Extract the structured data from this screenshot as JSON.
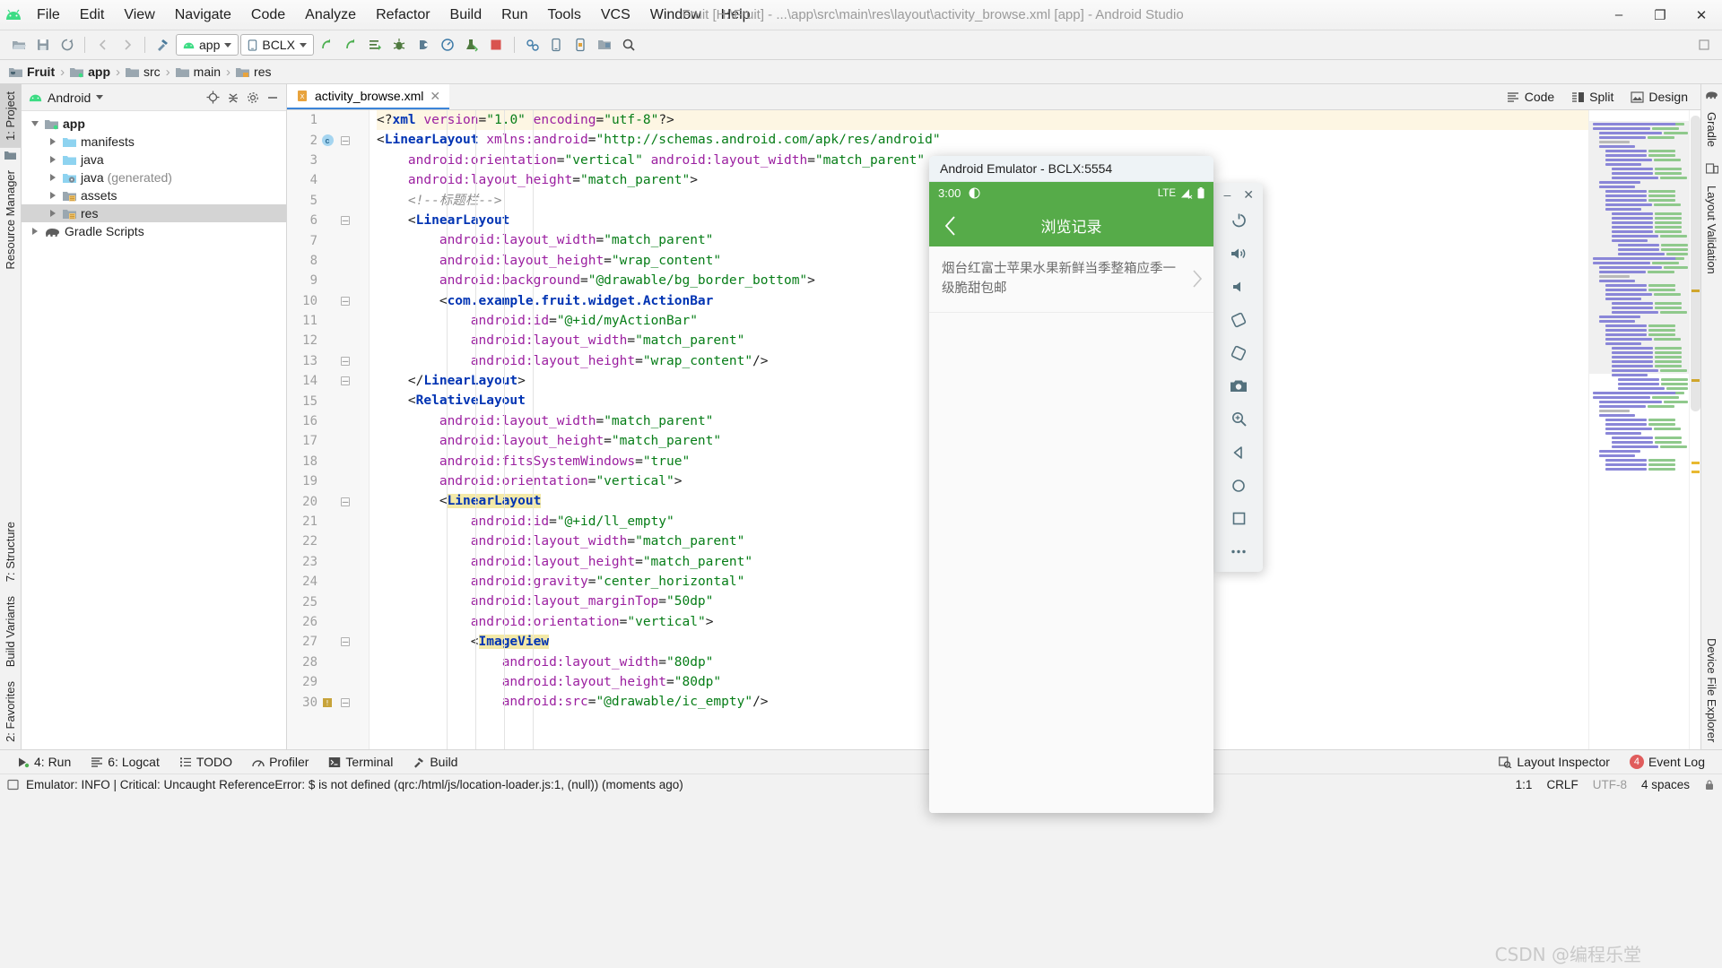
{
  "window": {
    "title": "Fruit [H:\\Fruit] - ...\\app\\src\\main\\res\\layout\\activity_browse.xml [app] - Android Studio",
    "minimize": "–",
    "maximize": "❐",
    "close": "✕"
  },
  "menubar": [
    {
      "label": "File"
    },
    {
      "label": "Edit"
    },
    {
      "label": "View"
    },
    {
      "label": "Navigate"
    },
    {
      "label": "Code"
    },
    {
      "label": "Analyze"
    },
    {
      "label": "Refactor"
    },
    {
      "label": "Build"
    },
    {
      "label": "Run"
    },
    {
      "label": "Tools"
    },
    {
      "label": "VCS"
    },
    {
      "label": "Window"
    },
    {
      "label": "Help"
    }
  ],
  "toolbar": {
    "module_selector": "app",
    "device_selector": "BCLX"
  },
  "breadcrumb": [
    {
      "label": "Fruit",
      "bold": true
    },
    {
      "label": "app",
      "bold": true
    },
    {
      "label": "src",
      "bold": false
    },
    {
      "label": "main",
      "bold": false
    },
    {
      "label": "res",
      "bold": false
    }
  ],
  "project_panel": {
    "title": "Android",
    "tree": [
      {
        "label": "app",
        "indent": 0,
        "expanded": true,
        "bold": true,
        "selected": false,
        "icon": "module-folder"
      },
      {
        "label": "manifests",
        "indent": 1,
        "expanded": false,
        "bold": false,
        "selected": false,
        "icon": "blue-folder"
      },
      {
        "label": "java",
        "indent": 1,
        "expanded": false,
        "bold": false,
        "selected": false,
        "icon": "blue-folder"
      },
      {
        "label": "java",
        "suffix": " (generated)",
        "indent": 1,
        "expanded": false,
        "bold": false,
        "selected": false,
        "icon": "generated-folder"
      },
      {
        "label": "assets",
        "indent": 1,
        "expanded": false,
        "bold": false,
        "selected": false,
        "icon": "res-folder"
      },
      {
        "label": "res",
        "indent": 1,
        "expanded": false,
        "bold": false,
        "selected": true,
        "icon": "res-folder"
      },
      {
        "label": "Gradle Scripts",
        "indent": 0,
        "expanded": false,
        "bold": false,
        "selected": false,
        "icon": "gradle"
      }
    ]
  },
  "left_rail": {
    "top": [
      {
        "label": "1: Project",
        "selected": true
      },
      {
        "label": "Resource Manager",
        "selected": false
      }
    ],
    "bottom": [
      {
        "label": "7: Structure"
      },
      {
        "label": "Build Variants"
      },
      {
        "label": "2: Favorites"
      }
    ]
  },
  "right_rail": [
    {
      "label": "Gradle"
    },
    {
      "label": "Layout Validation"
    }
  ],
  "editor": {
    "tab": {
      "name": "activity_browse.xml",
      "close": "✕"
    },
    "modes": [
      {
        "label": "Code",
        "active": false
      },
      {
        "label": "Split",
        "active": false
      },
      {
        "label": "Design",
        "active": false
      }
    ],
    "lines": [
      {
        "n": 1,
        "highlight": true,
        "fold": "",
        "mark": "",
        "indent": 0,
        "tokens": [
          {
            "t": "punc",
            "v": "<?"
          },
          {
            "t": "tag",
            "v": "xml"
          },
          {
            "t": "punc",
            "v": " "
          },
          {
            "t": "attr",
            "v": "version"
          },
          {
            "t": "eq",
            "v": "="
          },
          {
            "t": "val",
            "v": "\"1.0\""
          },
          {
            "t": "punc",
            "v": " "
          },
          {
            "t": "attr",
            "v": "encoding"
          },
          {
            "t": "eq",
            "v": "="
          },
          {
            "t": "val",
            "v": "\"utf-8\""
          },
          {
            "t": "punc",
            "v": "?>"
          }
        ]
      },
      {
        "n": 2,
        "highlight": false,
        "fold": "minus",
        "mark": "c",
        "indent": 0,
        "tokens": [
          {
            "t": "punc",
            "v": "<"
          },
          {
            "t": "tag",
            "v": "LinearLayout"
          },
          {
            "t": "punc",
            "v": " "
          },
          {
            "t": "attr",
            "v": "xmlns:android"
          },
          {
            "t": "eq",
            "v": "="
          },
          {
            "t": "val",
            "v": "\"http://schemas.android.com/apk/res/android\""
          }
        ]
      },
      {
        "n": 3,
        "highlight": false,
        "fold": "",
        "mark": "",
        "indent": 1,
        "tokens": [
          {
            "t": "attr",
            "v": "android:orientation"
          },
          {
            "t": "eq",
            "v": "="
          },
          {
            "t": "val",
            "v": "\"vertical\""
          },
          {
            "t": "punc",
            "v": " "
          },
          {
            "t": "attr",
            "v": "android:layout_width"
          },
          {
            "t": "eq",
            "v": "="
          },
          {
            "t": "val",
            "v": "\"match_parent\""
          }
        ]
      },
      {
        "n": 4,
        "highlight": false,
        "fold": "",
        "mark": "",
        "indent": 1,
        "tokens": [
          {
            "t": "attr",
            "v": "android:layout_height"
          },
          {
            "t": "eq",
            "v": "="
          },
          {
            "t": "val",
            "v": "\"match_parent\""
          },
          {
            "t": "punc",
            "v": ">"
          }
        ]
      },
      {
        "n": 5,
        "highlight": false,
        "fold": "",
        "mark": "",
        "indent": 1,
        "tokens": [
          {
            "t": "comment",
            "v": "<!--标题栏-->"
          }
        ]
      },
      {
        "n": 6,
        "highlight": false,
        "fold": "minus",
        "mark": "",
        "indent": 1,
        "tokens": [
          {
            "t": "punc",
            "v": "<"
          },
          {
            "t": "tag",
            "v": "LinearLayout"
          }
        ]
      },
      {
        "n": 7,
        "highlight": false,
        "fold": "",
        "mark": "",
        "indent": 2,
        "tokens": [
          {
            "t": "attr",
            "v": "android:layout_width"
          },
          {
            "t": "eq",
            "v": "="
          },
          {
            "t": "val",
            "v": "\"match_parent\""
          }
        ]
      },
      {
        "n": 8,
        "highlight": false,
        "fold": "",
        "mark": "",
        "indent": 2,
        "tokens": [
          {
            "t": "attr",
            "v": "android:layout_height"
          },
          {
            "t": "eq",
            "v": "="
          },
          {
            "t": "val",
            "v": "\"wrap_content\""
          }
        ]
      },
      {
        "n": 9,
        "highlight": false,
        "fold": "",
        "mark": "",
        "indent": 2,
        "tokens": [
          {
            "t": "attr",
            "v": "android:background"
          },
          {
            "t": "eq",
            "v": "="
          },
          {
            "t": "val",
            "v": "\"@drawable/bg_border_bottom\""
          },
          {
            "t": "punc",
            "v": ">"
          }
        ]
      },
      {
        "n": 10,
        "highlight": false,
        "fold": "minus",
        "mark": "",
        "indent": 2,
        "tokens": [
          {
            "t": "punc",
            "v": "<"
          },
          {
            "t": "tag",
            "v": "com.example.fruit.widget.ActionBar"
          }
        ]
      },
      {
        "n": 11,
        "highlight": false,
        "fold": "",
        "mark": "",
        "indent": 3,
        "tokens": [
          {
            "t": "attr",
            "v": "android:id"
          },
          {
            "t": "eq",
            "v": "="
          },
          {
            "t": "val",
            "v": "\"@+id/myActionBar\""
          }
        ]
      },
      {
        "n": 12,
        "highlight": false,
        "fold": "",
        "mark": "",
        "indent": 3,
        "tokens": [
          {
            "t": "attr",
            "v": "android:layout_width"
          },
          {
            "t": "eq",
            "v": "="
          },
          {
            "t": "val",
            "v": "\"match_parent\""
          }
        ]
      },
      {
        "n": 13,
        "highlight": false,
        "fold": "minus",
        "mark": "",
        "indent": 3,
        "tokens": [
          {
            "t": "attr",
            "v": "android:layout_height"
          },
          {
            "t": "eq",
            "v": "="
          },
          {
            "t": "val",
            "v": "\"wrap_content\""
          },
          {
            "t": "punc",
            "v": "/>"
          }
        ]
      },
      {
        "n": 14,
        "highlight": false,
        "fold": "minus",
        "mark": "",
        "indent": 1,
        "tokens": [
          {
            "t": "punc",
            "v": "</"
          },
          {
            "t": "tag",
            "v": "LinearLayout"
          },
          {
            "t": "punc",
            "v": ">"
          }
        ]
      },
      {
        "n": 15,
        "highlight": false,
        "fold": "",
        "mark": "",
        "indent": 1,
        "tokens": [
          {
            "t": "punc",
            "v": "<"
          },
          {
            "t": "tag",
            "v": "RelativeLayout"
          }
        ]
      },
      {
        "n": 16,
        "highlight": false,
        "fold": "",
        "mark": "",
        "indent": 2,
        "tokens": [
          {
            "t": "attr",
            "v": "android:layout_width"
          },
          {
            "t": "eq",
            "v": "="
          },
          {
            "t": "val",
            "v": "\"match_parent\""
          }
        ]
      },
      {
        "n": 17,
        "highlight": false,
        "fold": "",
        "mark": "",
        "indent": 2,
        "tokens": [
          {
            "t": "attr",
            "v": "android:layout_height"
          },
          {
            "t": "eq",
            "v": "="
          },
          {
            "t": "val",
            "v": "\"match_parent\""
          }
        ]
      },
      {
        "n": 18,
        "highlight": false,
        "fold": "",
        "mark": "",
        "indent": 2,
        "tokens": [
          {
            "t": "attr",
            "v": "android:fitsSystemWindows"
          },
          {
            "t": "eq",
            "v": "="
          },
          {
            "t": "val",
            "v": "\"true\""
          }
        ]
      },
      {
        "n": 19,
        "highlight": false,
        "fold": "",
        "mark": "",
        "indent": 2,
        "tokens": [
          {
            "t": "attr",
            "v": "android:orientation"
          },
          {
            "t": "eq",
            "v": "="
          },
          {
            "t": "val",
            "v": "\"vertical\""
          },
          {
            "t": "punc",
            "v": ">"
          }
        ]
      },
      {
        "n": 20,
        "highlight": false,
        "fold": "minus",
        "mark": "",
        "indent": 2,
        "tokens": [
          {
            "t": "punc",
            "v": "<"
          },
          {
            "t": "tag-hl",
            "v": "LinearLayout"
          }
        ]
      },
      {
        "n": 21,
        "highlight": false,
        "fold": "",
        "mark": "",
        "indent": 3,
        "tokens": [
          {
            "t": "attr",
            "v": "android:id"
          },
          {
            "t": "eq",
            "v": "="
          },
          {
            "t": "val",
            "v": "\"@+id/ll_empty\""
          }
        ]
      },
      {
        "n": 22,
        "highlight": false,
        "fold": "",
        "mark": "",
        "indent": 3,
        "tokens": [
          {
            "t": "attr",
            "v": "android:layout_width"
          },
          {
            "t": "eq",
            "v": "="
          },
          {
            "t": "val",
            "v": "\"match_parent\""
          }
        ]
      },
      {
        "n": 23,
        "highlight": false,
        "fold": "",
        "mark": "",
        "indent": 3,
        "tokens": [
          {
            "t": "attr",
            "v": "android:layout_height"
          },
          {
            "t": "eq",
            "v": "="
          },
          {
            "t": "val",
            "v": "\"match_parent\""
          }
        ]
      },
      {
        "n": 24,
        "highlight": false,
        "fold": "",
        "mark": "",
        "indent": 3,
        "tokens": [
          {
            "t": "attr",
            "v": "android:gravity"
          },
          {
            "t": "eq",
            "v": "="
          },
          {
            "t": "val",
            "v": "\"center_horizontal\""
          }
        ]
      },
      {
        "n": 25,
        "highlight": false,
        "fold": "",
        "mark": "",
        "indent": 3,
        "tokens": [
          {
            "t": "attr",
            "v": "android:layout_marginTop"
          },
          {
            "t": "eq",
            "v": "="
          },
          {
            "t": "val",
            "v": "\"50dp\""
          }
        ]
      },
      {
        "n": 26,
        "highlight": false,
        "fold": "",
        "mark": "",
        "indent": 3,
        "tokens": [
          {
            "t": "attr",
            "v": "android:orientation"
          },
          {
            "t": "eq",
            "v": "="
          },
          {
            "t": "val",
            "v": "\"vertical\""
          },
          {
            "t": "punc",
            "v": ">"
          }
        ]
      },
      {
        "n": 27,
        "highlight": false,
        "fold": "minus",
        "mark": "",
        "indent": 3,
        "tokens": [
          {
            "t": "punc",
            "v": "<"
          },
          {
            "t": "tag-hl",
            "v": "ImageView"
          }
        ]
      },
      {
        "n": 28,
        "highlight": false,
        "fold": "",
        "mark": "",
        "indent": 4,
        "tokens": [
          {
            "t": "attr",
            "v": "android:layout_width"
          },
          {
            "t": "eq",
            "v": "="
          },
          {
            "t": "val",
            "v": "\"80dp\""
          }
        ]
      },
      {
        "n": 29,
        "highlight": false,
        "fold": "",
        "mark": "",
        "indent": 4,
        "tokens": [
          {
            "t": "attr",
            "v": "android:layout_height"
          },
          {
            "t": "eq",
            "v": "="
          },
          {
            "t": "val",
            "v": "\"80dp\""
          }
        ]
      },
      {
        "n": 30,
        "highlight": false,
        "fold": "minus",
        "mark": "warn",
        "indent": 4,
        "tokens": [
          {
            "t": "attr",
            "v": "android:src"
          },
          {
            "t": "eq",
            "v": "="
          },
          {
            "t": "val",
            "v": "\"@drawable/ic_empty\""
          },
          {
            "t": "punc",
            "v": "/>"
          }
        ]
      }
    ]
  },
  "emulator": {
    "title": "Android Emulator - BCLX:5554",
    "status": {
      "time": "3:00",
      "network": "LTE"
    },
    "appbar": {
      "back": "‹",
      "title": "浏览记录"
    },
    "list": [
      {
        "text": "烟台红富士苹果水果新鲜当季整箱应季一级脆甜包邮",
        "chevron": "›"
      }
    ],
    "side_controls": [
      {
        "name": "power"
      },
      {
        "name": "volume-up"
      },
      {
        "name": "volume-down"
      },
      {
        "name": "rotate-left"
      },
      {
        "name": "rotate-right"
      },
      {
        "name": "screenshot"
      },
      {
        "name": "zoom"
      },
      {
        "name": "back"
      },
      {
        "name": "home"
      },
      {
        "name": "overview"
      },
      {
        "name": "more"
      }
    ],
    "minimize": "–",
    "close": "✕"
  },
  "bottom_bar": {
    "items": [
      {
        "label": "4: Run",
        "icon": "run-icon"
      },
      {
        "label": "6: Logcat",
        "icon": "logcat-icon"
      },
      {
        "label": "TODO",
        "icon": "todo-icon"
      },
      {
        "label": "Profiler",
        "icon": "profiler-icon"
      },
      {
        "label": "Terminal",
        "icon": "terminal-icon"
      },
      {
        "label": "Build",
        "icon": "build-icon"
      }
    ],
    "right": [
      {
        "label": "Layout Inspector",
        "icon": "layout-inspector-icon",
        "badge": ""
      },
      {
        "label": "Event Log",
        "icon": "event-log-icon",
        "badge": "4"
      }
    ]
  },
  "status_bar": {
    "message": "Emulator: INFO   | Critical: Uncaught ReferenceError: $ is not defined (qrc:/html/js/location-loader.js:1, (null)) (moments ago)",
    "caret": "1:1",
    "line_sep": "CRLF",
    "encoding": "UTF-8",
    "indent": "4 spaces"
  },
  "watermark": "CSDN @编程乐堂",
  "colors": {
    "accent_green": "#56ab49",
    "tag_blue": "#0033b3",
    "attr_purple": "#9b1fa0",
    "value_green": "#067d17",
    "highlight_line": "#fdf6e3",
    "selection": "#d4d4d4"
  }
}
